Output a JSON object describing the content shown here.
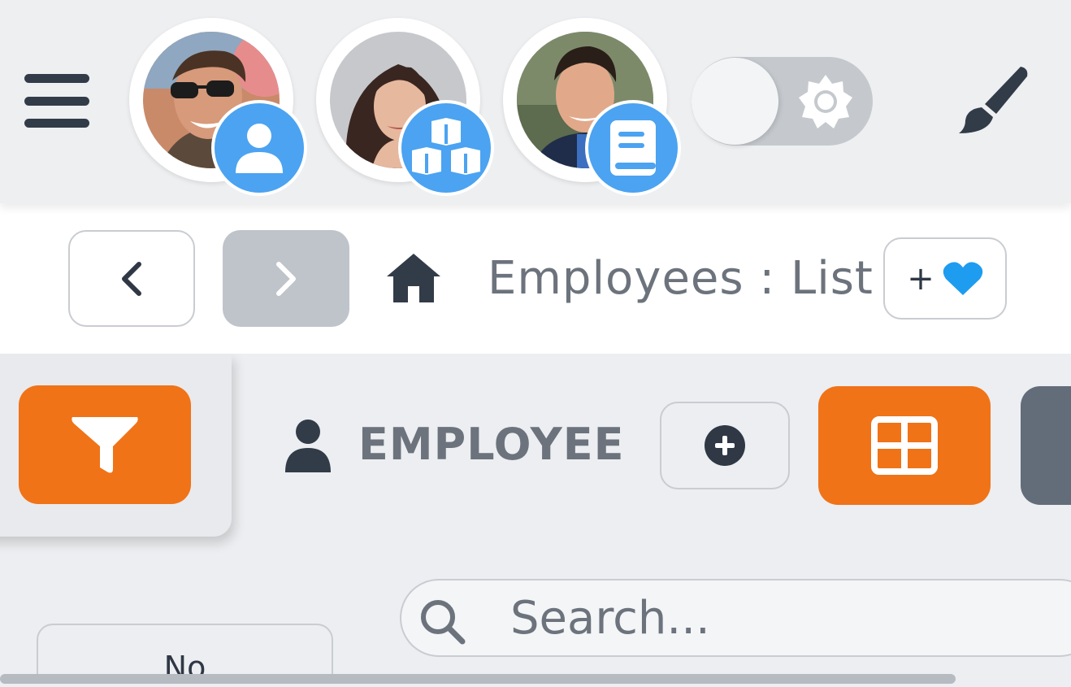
{
  "topbar": {
    "menu_icon": "hamburger-menu-icon",
    "avatars": [
      {
        "badge_icon": "user-icon",
        "badge_color": "#4ba3f1"
      },
      {
        "badge_icon": "cubes-icon",
        "badge_color": "#4ba3f1"
      },
      {
        "badge_icon": "book-icon",
        "badge_color": "#4ba3f1"
      }
    ],
    "theme_toggle": {
      "state": "off",
      "icon": "sun-icon"
    },
    "brush_icon": "paintbrush-icon"
  },
  "breadcrumb": {
    "back_icon": "chevron-left-icon",
    "forward_icon": "chevron-right-icon",
    "home_icon": "home-icon",
    "text": "Employees : List",
    "favorite_plus": "+",
    "favorite_icon": "heart-icon",
    "favorite_color": "#1e9cf0"
  },
  "main": {
    "filter_icon": "funnel-icon",
    "section_icon": "person-icon",
    "section_title": "EMPLOYEE",
    "add_icon": "plus-circle-icon",
    "grid_icon": "grid-view-icon",
    "accent_color": "#f07318",
    "search": {
      "placeholder": "Search...",
      "value": ""
    },
    "table": {
      "columns": [
        "No"
      ]
    }
  }
}
